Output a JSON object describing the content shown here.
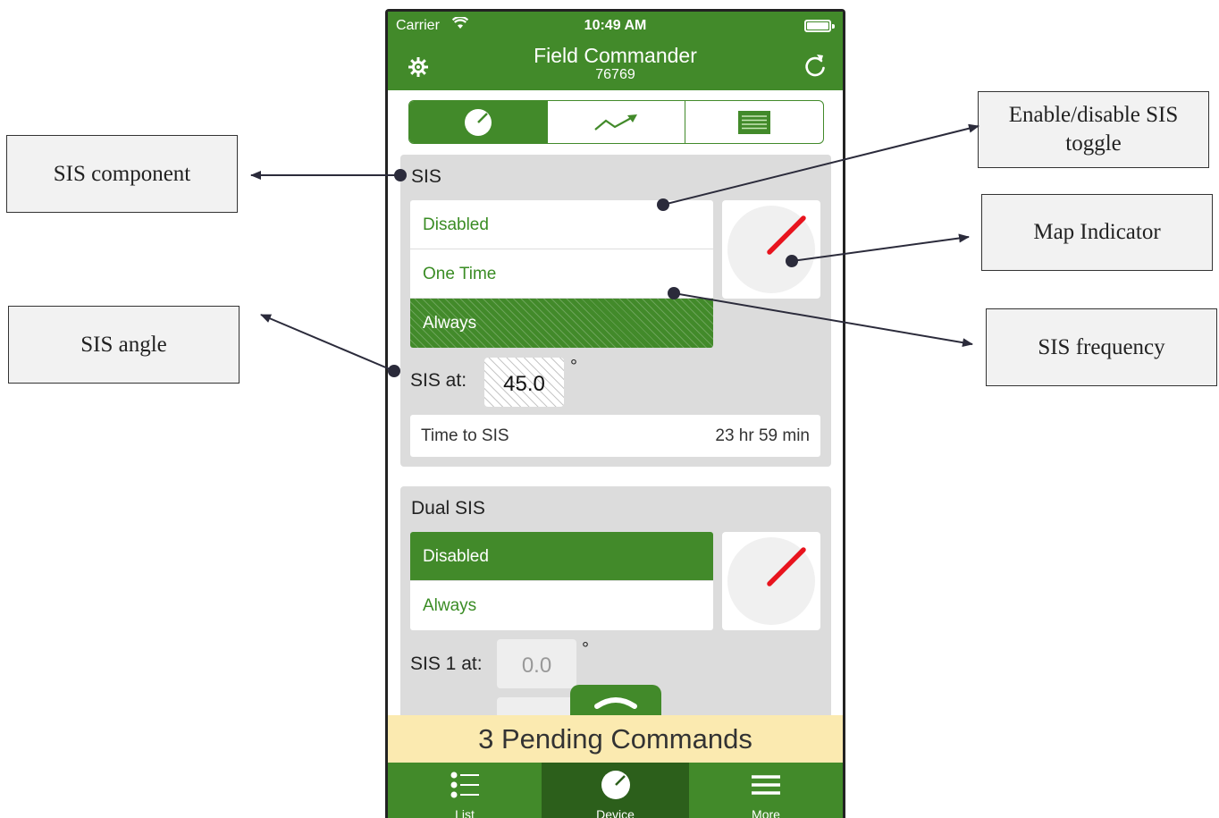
{
  "annotations": {
    "sis_component": "SIS component",
    "sis_angle": "SIS angle",
    "toggle": "Enable/disable SIS toggle",
    "map_indicator": "Map Indicator",
    "sis_frequency": "SIS frequency"
  },
  "status_bar": {
    "carrier": "Carrier",
    "time": "10:49 AM"
  },
  "header": {
    "title": "Field Commander",
    "subtitle": "76769"
  },
  "segmented_control": {
    "items": [
      {
        "icon": "gauge-icon",
        "active": true
      },
      {
        "icon": "trend-chart-icon",
        "active": false
      },
      {
        "icon": "table-list-icon",
        "active": false
      }
    ]
  },
  "sis": {
    "title": "SIS",
    "options": [
      {
        "label": "Disabled",
        "selected": false
      },
      {
        "label": "One Time",
        "selected": false
      },
      {
        "label": "Always",
        "selected": true
      }
    ],
    "angle_label": "SIS at:",
    "angle_value": "45.0",
    "degree_symbol": "°",
    "time_label": "Time to SIS",
    "time_value": "23 hr 59 min"
  },
  "dual_sis": {
    "title": "Dual SIS",
    "options": [
      {
        "label": "Disabled",
        "selected": true
      },
      {
        "label": "Always",
        "selected": false
      }
    ],
    "sis1_label": "SIS 1 at:",
    "sis1_value": "0.0",
    "degree_symbol": "°"
  },
  "pending_banner": "3 Pending Commands",
  "tabs": [
    {
      "label": "List",
      "icon": "list-icon",
      "active": false
    },
    {
      "label": "Device",
      "icon": "gauge-icon",
      "active": true
    },
    {
      "label": "More",
      "icon": "menu-icon",
      "active": false
    }
  ],
  "colors": {
    "brand_green": "#428a2a",
    "dark_green": "#2c5f1b",
    "banner": "#fbeab0",
    "indicator": "#e8141e"
  }
}
